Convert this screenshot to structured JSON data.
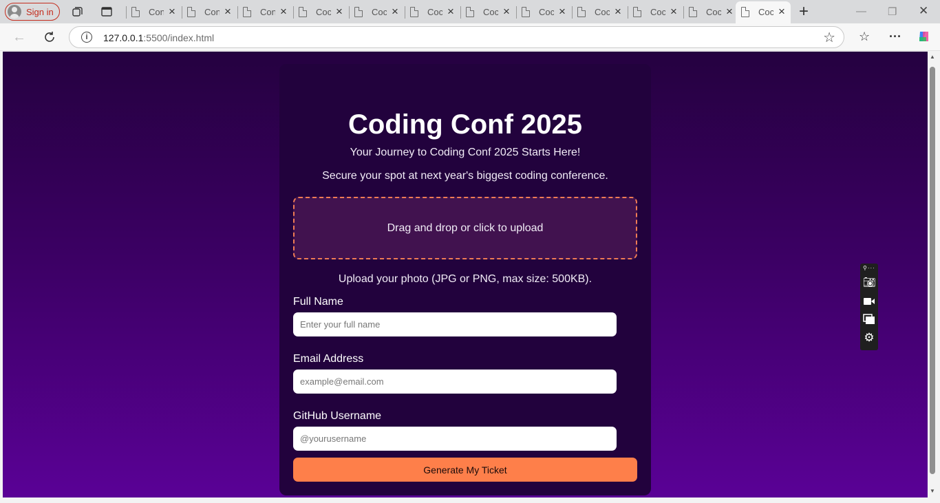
{
  "browser": {
    "signin_label": "Sign in",
    "tabs": [
      {
        "title": "Con"
      },
      {
        "title": "Con"
      },
      {
        "title": "Con"
      },
      {
        "title": "Coc"
      },
      {
        "title": "Coc"
      },
      {
        "title": "Coc"
      },
      {
        "title": "Coc"
      },
      {
        "title": "Coc"
      },
      {
        "title": "Coc"
      },
      {
        "title": "Coc"
      },
      {
        "title": "Coc"
      },
      {
        "title": "Coc"
      }
    ],
    "url_host": "127.0.0.1",
    "url_rest": ":5500/index.html"
  },
  "page": {
    "title": "Coding Conf 2025",
    "subtitle_1": "Your Journey to Coding Conf 2025 Starts Here!",
    "subtitle_2": "Secure your spot at next year's biggest coding conference.",
    "dropzone_text": "Drag and drop or click to upload",
    "upload_hint": "Upload your photo (JPG or PNG, max size: 500KB).",
    "full_name": {
      "label": "Full Name",
      "placeholder": "Enter your full name"
    },
    "email": {
      "label": "Email Address",
      "placeholder": "example@email.com"
    },
    "github": {
      "label": "GitHub Username",
      "placeholder": "@yourusername"
    },
    "submit_label": "Generate My Ticket"
  },
  "colors": {
    "accent": "#fe7f4a",
    "card": "#22023d",
    "background_top": "#250140",
    "background_bottom": "#5a0196"
  }
}
